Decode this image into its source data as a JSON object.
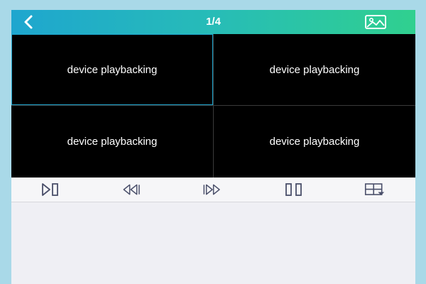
{
  "header": {
    "page_indicator": "1/4",
    "back_icon": "chevron-left-icon",
    "image_icon": "picture-icon",
    "gradient_start": "#1ea6cf",
    "gradient_end": "#30d08f"
  },
  "grid": {
    "cells": [
      {
        "label": "device playbacking",
        "selected": true
      },
      {
        "label": "device playbacking",
        "selected": false
      },
      {
        "label": "device playbacking",
        "selected": false
      },
      {
        "label": "device playbacking",
        "selected": false
      }
    ]
  },
  "toolbar": {
    "items": [
      {
        "name": "play-pause-icon"
      },
      {
        "name": "rewind-icon"
      },
      {
        "name": "fast-forward-icon"
      },
      {
        "name": "pause-icon"
      },
      {
        "name": "split-screen-layout-icon"
      }
    ]
  },
  "colors": {
    "accent": "#1ea6cf",
    "icon_color": "#4a4f6a",
    "background": "#efeff4"
  }
}
